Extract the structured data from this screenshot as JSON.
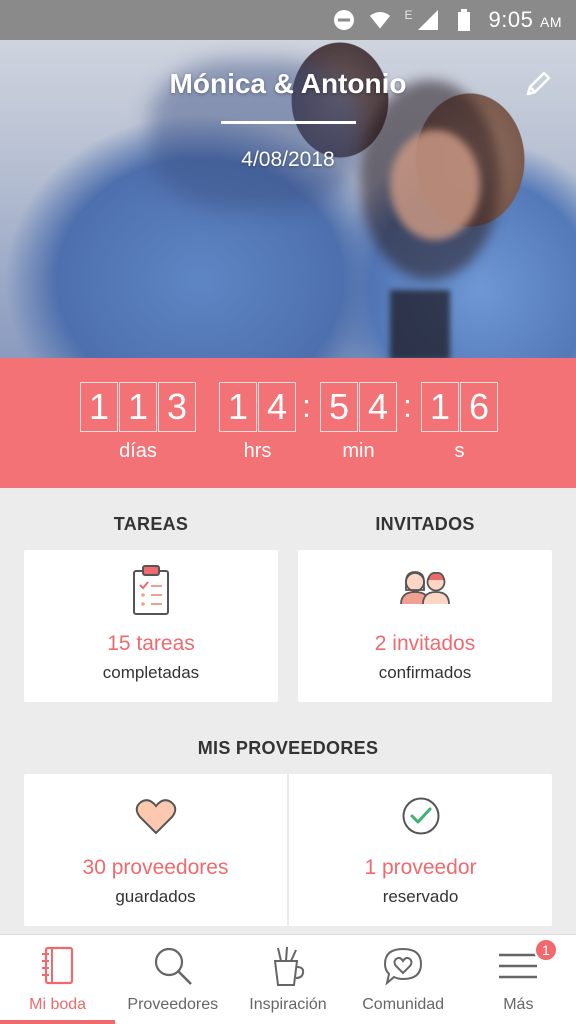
{
  "status_bar": {
    "time": "9:05",
    "ampm": "AM",
    "network_label": "E"
  },
  "hero": {
    "title": "Mónica & Antonio",
    "date": "4/08/2018"
  },
  "countdown": {
    "days": [
      "1",
      "1",
      "3"
    ],
    "hours": [
      "1",
      "4"
    ],
    "minutes": [
      "5",
      "4"
    ],
    "seconds": [
      "1",
      "6"
    ],
    "labels": {
      "days": "días",
      "hours": "hrs",
      "minutes": "min",
      "seconds": "s"
    }
  },
  "tasks": {
    "heading": "TAREAS",
    "value": "15 tareas",
    "caption": "completadas"
  },
  "guests": {
    "heading": "INVITADOS",
    "value": "2 invitados",
    "caption": "confirmados"
  },
  "vendors": {
    "heading": "MIS PROVEEDORES",
    "saved": {
      "value": "30 proveedores",
      "caption": "guardados"
    },
    "booked": {
      "value": "1 proveedor",
      "caption": "reservado"
    }
  },
  "tabbar": {
    "items": [
      {
        "label": "Mi boda",
        "icon": "notebook-icon",
        "active": true
      },
      {
        "label": "Proveedores",
        "icon": "search-icon"
      },
      {
        "label": "Inspiración",
        "icon": "cup-icon"
      },
      {
        "label": "Comunidad",
        "icon": "chat-heart-icon"
      },
      {
        "label": "Más",
        "icon": "menu-icon",
        "badge": "1"
      }
    ]
  },
  "colors": {
    "accent": "#f27275",
    "text_accent": "#f06a6d",
    "status_bar": "#8a8a8a"
  }
}
